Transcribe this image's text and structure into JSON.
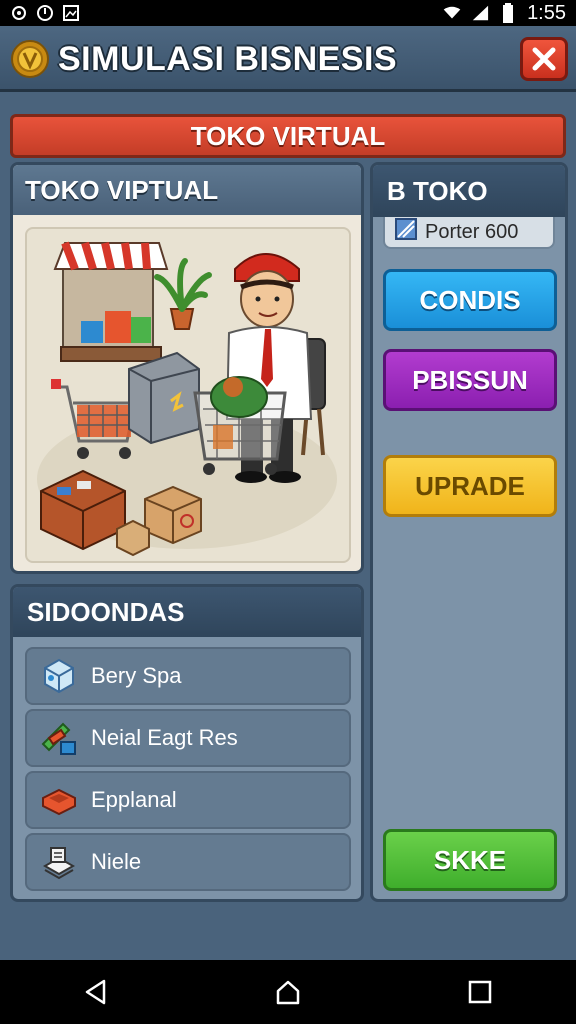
{
  "status_bar": {
    "time": "1:55",
    "left_icons": [
      "notification-icon",
      "record-icon",
      "image-icon"
    ],
    "right_icons": [
      "wifi-icon",
      "signal-icon",
      "battery-icon"
    ]
  },
  "header": {
    "title": "SIMULASI BISNESIS",
    "logo_icon": "gold-coin-icon",
    "close_icon": "close-icon",
    "close_color": "#e2452f"
  },
  "banner": {
    "text": "TOKO VIRTUAL"
  },
  "store": {
    "title": "TOKO VIPTUAL"
  },
  "side": {
    "title": "B TOKO",
    "porter_label": "Porter 600",
    "buttons": [
      {
        "label": "CONDIS",
        "color": "#1f9de6"
      },
      {
        "label": "PBISSUN",
        "color": "#9b2bc0"
      },
      {
        "label": "UPRADE",
        "color": "#f5c52c"
      },
      {
        "label": "SKKE",
        "color": "#4cbd34"
      }
    ]
  },
  "list": {
    "title": "SIDOONDAS",
    "items": [
      {
        "label": "Bery Spa",
        "icon": "cube-box-icon"
      },
      {
        "label": "Neial Eagt Res",
        "icon": "blocks-icon"
      },
      {
        "label": "Epplanal",
        "icon": "tray-icon"
      },
      {
        "label": "Niele",
        "icon": "paper-stack-icon"
      }
    ]
  },
  "nav": {
    "icons": [
      "back-icon",
      "home-icon",
      "recents-icon"
    ]
  }
}
